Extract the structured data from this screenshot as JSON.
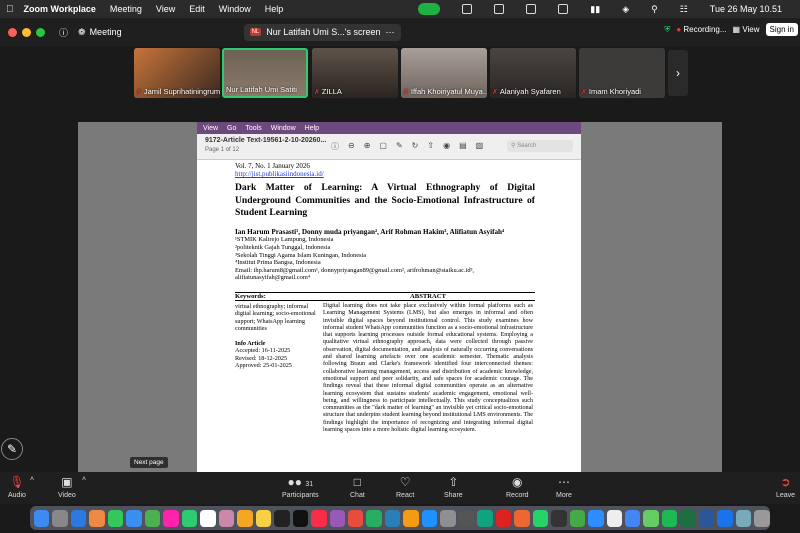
{
  "menubar": {
    "app": "Zoom Workplace",
    "items": [
      "Meeting",
      "View",
      "Edit",
      "Window",
      "Help"
    ],
    "clock": "Tue 26 May 10.51"
  },
  "zoom_top": {
    "meeting_label": "Meeting",
    "screen_share_label": "Nur Latifah Umi S...'s screen",
    "recording_label": "Recording...",
    "view_label": "View",
    "sign_in_label": "Sign in"
  },
  "participants": [
    {
      "name": "Jamil Suprihatiningrum",
      "bg": "#9a7850"
    },
    {
      "name": "Nur Latifah Umi Satiti",
      "bg": "#7e6a5a"
    },
    {
      "name": "ZILLA",
      "bg": "#6b5f54"
    },
    {
      "name": "Iffah Khoiriyatul Muya...",
      "bg": "#8a7f78"
    },
    {
      "name": "Alaniyah Syafaren",
      "bg": "#4f4a47"
    },
    {
      "name": "Imam Khoriyadi",
      "bg": "#3d3a3a"
    }
  ],
  "preview": {
    "menu": [
      "View",
      "Go",
      "Tools",
      "Window",
      "Help"
    ],
    "doc_title": "9172-Article Text-19561-2-10-20260...",
    "page_indicator": "Page 1 of 12",
    "search_placeholder": "Search"
  },
  "paper": {
    "volume": "Vol. 7, No. 1 January 2026",
    "url": "http://jist.publikasiindonesia.id/",
    "title": "Dark Matter of Learning: A Virtual Ethnography of Digital Underground Communities and the Socio-Emotional Infrastructure of Student Learning",
    "authors": "Ian Harum Prasasti¹, Donny muda priyangan², Arif Rohman Hakim³, Alifiatun Asyifah⁴",
    "affiliations": [
      "¹STMIK Kalirejo Lampung, Indonesia",
      "²politeknik Gajah Tunggal, Indonesia",
      "³Sekolah Tinggi Agama Islam Kuningan, Indonesia",
      "⁴Institut Prima Bangsa, Indonesia",
      "Email: ihp.harum8@gmail.com¹, donnypriyangan89@gmail.com², arifrohman@staiku.ac.id³,",
      "alifiatunasyifah@gmail.com⁴"
    ],
    "keywords_head": "Keywords:",
    "abstract_head": "ABSTRACT",
    "keywords": "virtual ethnography; informal digital learning; socio-emotional support; WhatsApp learning communities",
    "info_head": "Info Article",
    "accepted": "Accepted: 16-11-2025",
    "revised": "Revised: 18-12-2025",
    "approved": "Approved: 25-01-2025",
    "abstract": "Digital learning does not take place exclusively within formal platforms such as Learning Management Systems (LMS), but also emerges in informal and often invisible digital spaces beyond institutional control. This study examines how informal student WhatsApp communities function as a socio-emotional infrastructure that supports learning processes outside formal educational systems. Employing a qualitative virtual ethnography approach, data were collected through passive observation, digital documentation, and analysis of naturally occurring conversations and shared learning artefacts over one academic semester. Thematic analysis following Braun and Clarke's framework identified four interconnected themes: collaborative learning management, access and distribution of academic knowledge, emotional support and peer solidarity, and safe spaces for academic courage. The findings reveal that these informal digital communities operate as an alternative learning ecosystem that sustains students' academic engagement, emotional well-being, and willingness to participate intellectually. This study conceptualizes such communities as the \"dark matter of learning\" an invisible yet critical socio-emotional structure that underpins student learning beyond institutional LMS environments. The findings highlight the importance of recognizing and integrating informal digital learning spaces into a more holistic digital learning ecosystem."
  },
  "toolbar": {
    "audio": "Audio",
    "video": "Video",
    "participants": "Participants",
    "participants_count": "31",
    "chat": "Chat",
    "react": "React",
    "share": "Share",
    "record": "Record",
    "more": "More",
    "leave": "Leave",
    "tooltip": "Next page"
  },
  "dock_apps": [
    "finder-icon",
    "launchpad-icon",
    "safari-icon",
    "chrome-icon",
    "messages-icon",
    "mail-icon",
    "maps-icon",
    "photos-icon",
    "facetime-icon",
    "calendar-icon",
    "contacts-icon",
    "reminders-icon",
    "notes-icon",
    "freeform-icon",
    "tv-icon",
    "music-icon",
    "podcasts-icon",
    "news-icon",
    "numbers-icon",
    "keynote-icon",
    "pages-icon",
    "appstore-icon",
    "settings-icon",
    "iphone-mirroring-icon",
    "chatgpt-icon",
    "photobooth-icon",
    "anydesk-icon",
    "whatsapp-icon",
    "terminal-icon",
    "activity-icon",
    "zoom-icon",
    "textedit-icon",
    "chrome-icon-2",
    "maps-icon-2",
    "spotify-icon",
    "excel-icon",
    "word-icon",
    "vpn-icon",
    "downloads-icon",
    "trash-icon"
  ]
}
